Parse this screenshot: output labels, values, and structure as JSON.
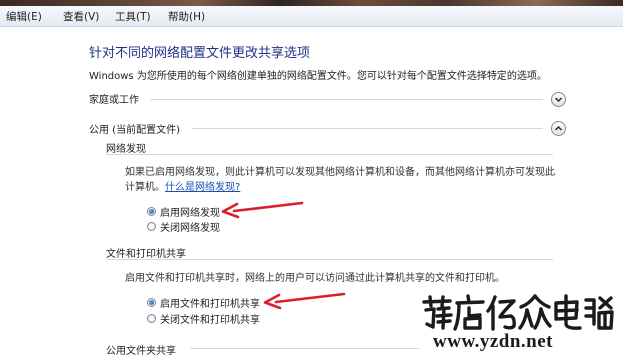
{
  "menu": {
    "items": [
      {
        "label": "编辑(E)"
      },
      {
        "label": "查看(V)"
      },
      {
        "label": "工具(T)"
      },
      {
        "label": "帮助(H)"
      }
    ]
  },
  "page": {
    "title": "针对不同的网络配置文件更改共享选项",
    "description": "Windows 为您所使用的每个网络创建单独的网络配置文件。您可以针对每个配置文件选择特定的选项。"
  },
  "profiles": {
    "home_work": {
      "label": "家庭或工作",
      "expand_icon": "chevron-down-icon"
    },
    "public": {
      "label": "公用 (当前配置文件)",
      "collapse_icon": "chevron-up-icon"
    }
  },
  "network_discovery": {
    "heading": "网络发现",
    "desc_line1": "如果已启用网络发现，则此计算机可以发现其他网络计算机和设备，而其他网络计算机亦可发现此",
    "desc_line2": "计算机。",
    "help_link": "什么是网络发现?",
    "options": [
      {
        "label": "启用网络发现",
        "selected": true
      },
      {
        "label": "关闭网络发现",
        "selected": false
      }
    ]
  },
  "file_printer_sharing": {
    "heading": "文件和打印机共享",
    "desc": "启用文件和打印机共享时，网络上的用户可以访问通过此计算机共享的文件和打印机。",
    "options": [
      {
        "label": "启用文件和打印机共享",
        "selected": true
      },
      {
        "label": "关闭文件和打印机共享",
        "selected": false
      }
    ]
  },
  "public_folder_sharing": {
    "heading": "公用文件夹共享"
  },
  "annotations": {
    "arrow_color": "#d9202a"
  },
  "watermark": {
    "logo_text": "藤店亿众电脑",
    "url": "www.yzdn.net"
  },
  "colors": {
    "title": "#1e3287",
    "link": "#1a4fb6",
    "arrow": "#d9202a"
  }
}
